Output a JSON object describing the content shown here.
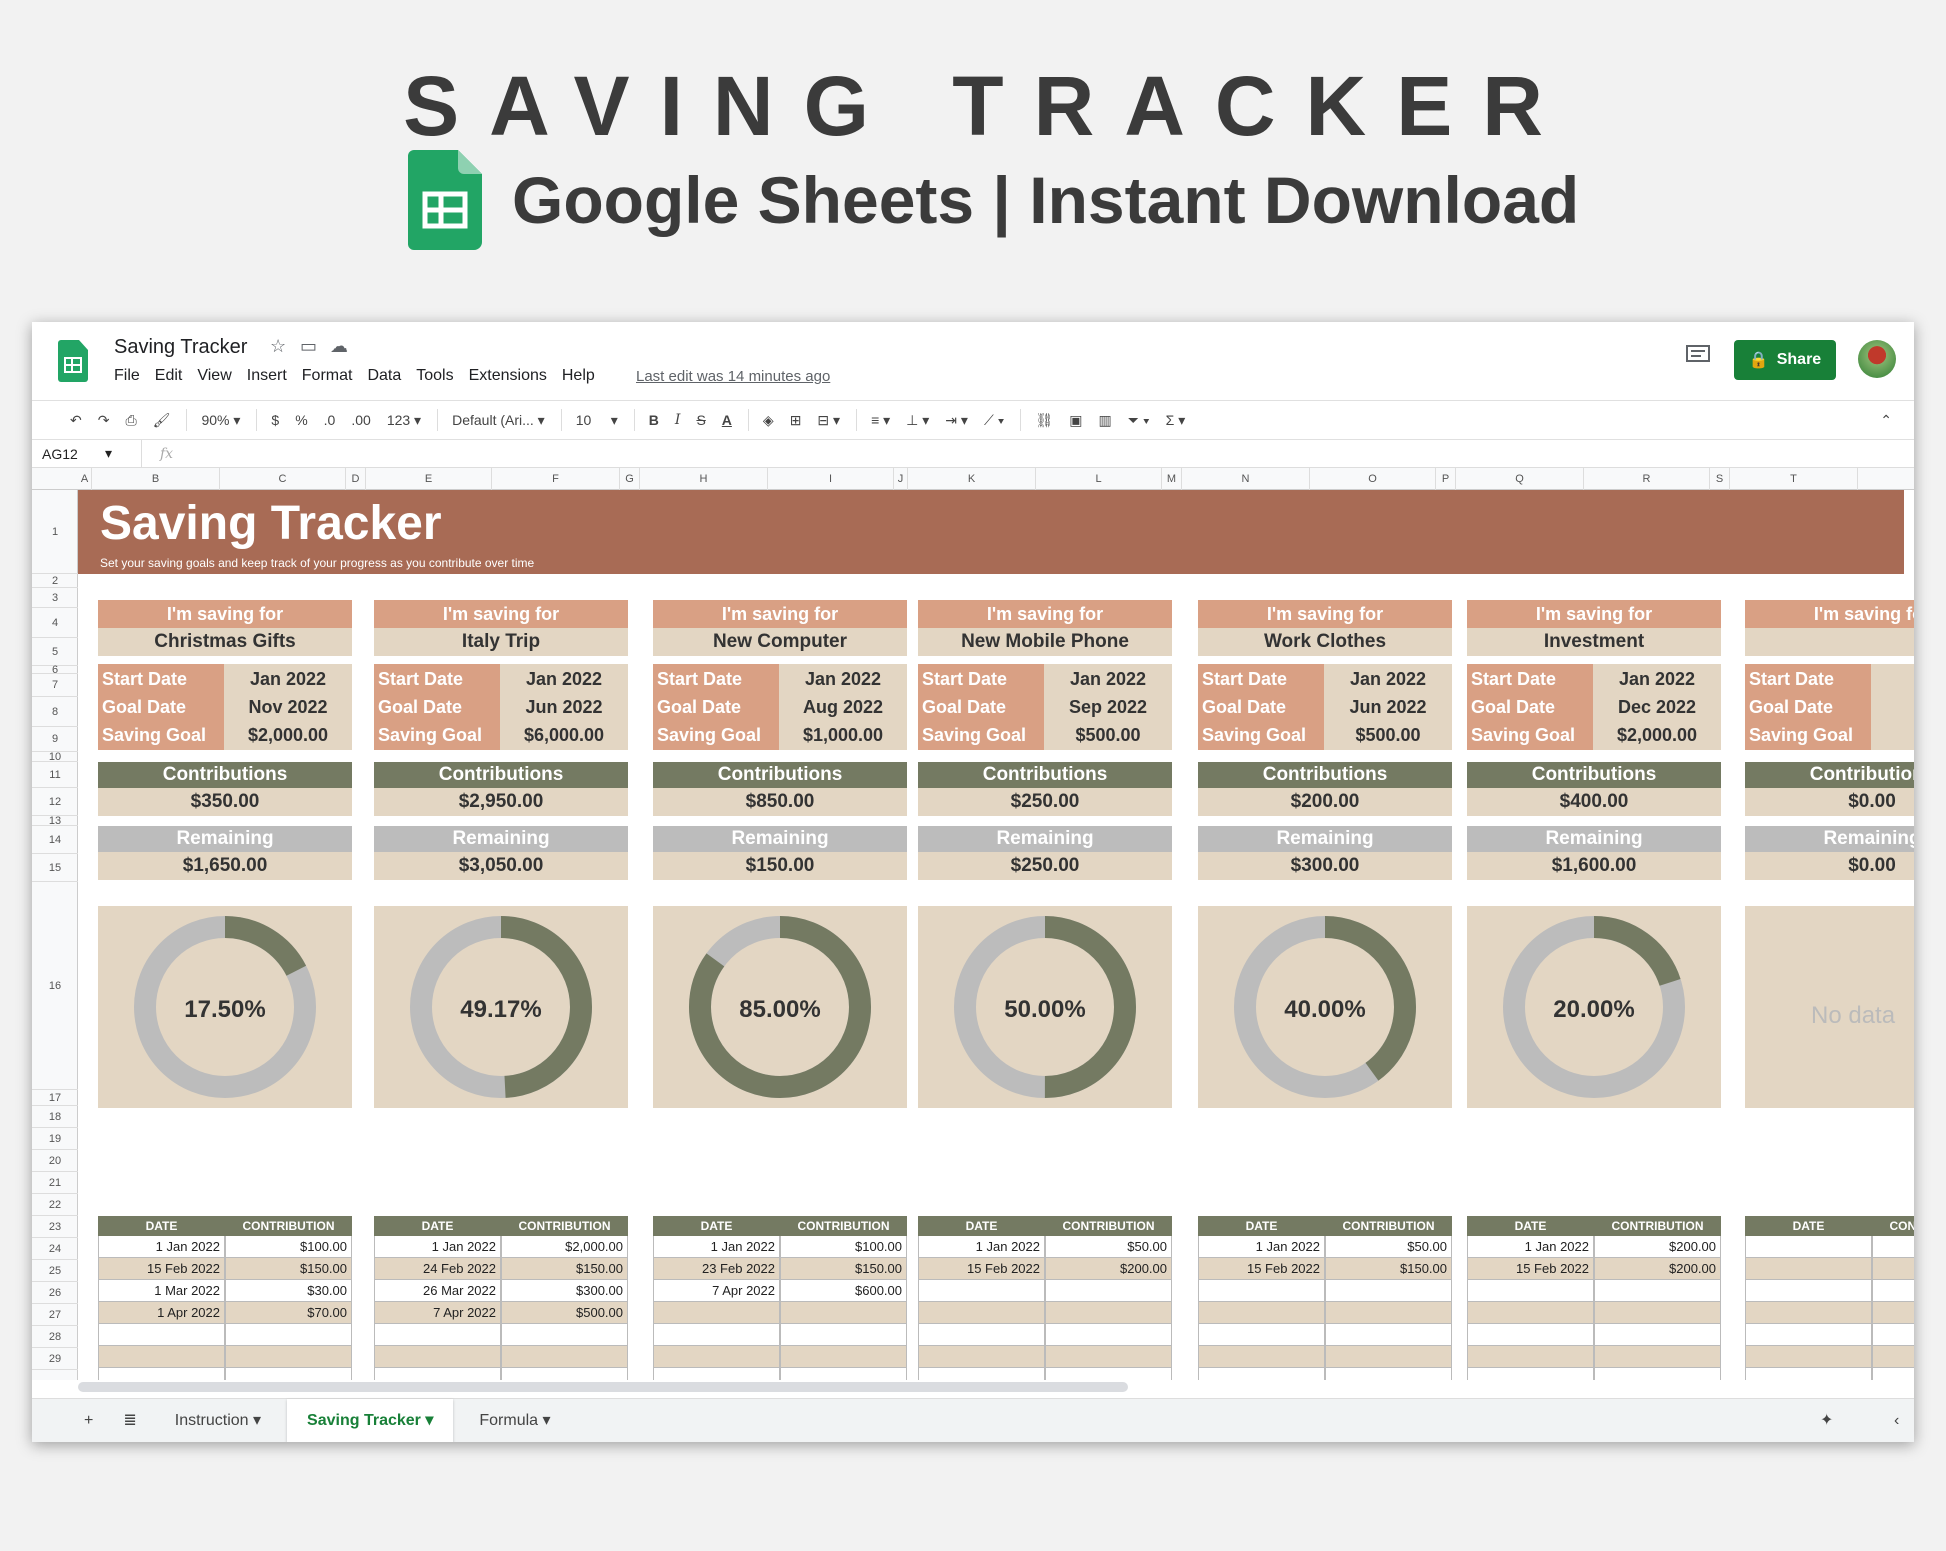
{
  "hero": {
    "title": "SAVING TRACKER",
    "subtitle": "Google Sheets | Instant Download"
  },
  "doc": {
    "title": "Saving Tracker",
    "last_edit": "Last edit was 14 minutes ago",
    "share": "Share"
  },
  "menu": [
    "File",
    "Edit",
    "View",
    "Insert",
    "Format",
    "Data",
    "Tools",
    "Extensions",
    "Help"
  ],
  "toolbar": {
    "zoom": "90%",
    "currency": "$",
    "percent": "%",
    "dec_less": ".0",
    "dec_more": ".00",
    "format": "123",
    "font": "Default (Ari...",
    "size": "10",
    "bold": "B",
    "italic": "I",
    "strike": "S",
    "textcolor": "A",
    "sum": "Σ"
  },
  "name_box": "AG12",
  "fx": "fx",
  "columns": [
    "A",
    "B",
    "C",
    "D",
    "E",
    "F",
    "G",
    "H",
    "I",
    "J",
    "K",
    "L",
    "M",
    "N",
    "O",
    "P",
    "Q",
    "R",
    "S",
    "T"
  ],
  "rows": [
    "1",
    "2",
    "3",
    "4",
    "5",
    "6",
    "7",
    "8",
    "9",
    "10",
    "11",
    "12",
    "13",
    "14",
    "15",
    "16",
    "17",
    "18",
    "19",
    "20",
    "21",
    "22",
    "23",
    "24",
    "25",
    "26",
    "27",
    "28",
    "29"
  ],
  "banner": {
    "title": "Saving Tracker",
    "subtitle": "Set your saving goals and keep track of your progress as you contribute over time"
  },
  "labels": {
    "saving_for": "I'm saving for",
    "start": "Start Date",
    "goal": "Goal Date",
    "saving_goal": "Saving Goal",
    "contributions": "Contributions",
    "remaining": "Remaining",
    "date": "DATE",
    "contribution": "CONTRIBUTION",
    "no_data": "No data"
  },
  "colors": {
    "accent": "#a86b55",
    "salmon": "#d9a084",
    "beige": "#e3d6c3",
    "olive": "#747a62",
    "gray": "#bcbcbc",
    "share": "#188038"
  },
  "goals": [
    {
      "name": "Christmas Gifts",
      "start": "Jan 2022",
      "goal": "Nov 2022",
      "target": "$2,000.00",
      "contributions": "$350.00",
      "remaining": "$1,650.00",
      "pct_label": "17.50%",
      "pct": 0.175,
      "rows": [
        [
          "1 Jan 2022",
          "$100.00"
        ],
        [
          "15 Feb 2022",
          "$150.00"
        ],
        [
          "1 Mar 2022",
          "$30.00"
        ],
        [
          "1 Apr 2022",
          "$70.00"
        ]
      ]
    },
    {
      "name": "Italy Trip",
      "start": "Jan 2022",
      "goal": "Jun 2022",
      "target": "$6,000.00",
      "contributions": "$2,950.00",
      "remaining": "$3,050.00",
      "pct_label": "49.17%",
      "pct": 0.4917,
      "rows": [
        [
          "1 Jan 2022",
          "$2,000.00"
        ],
        [
          "24 Feb 2022",
          "$150.00"
        ],
        [
          "26 Mar 2022",
          "$300.00"
        ],
        [
          "7 Apr 2022",
          "$500.00"
        ]
      ]
    },
    {
      "name": "New Computer",
      "start": "Jan 2022",
      "goal": "Aug 2022",
      "target": "$1,000.00",
      "contributions": "$850.00",
      "remaining": "$150.00",
      "pct_label": "85.00%",
      "pct": 0.85,
      "rows": [
        [
          "1 Jan 2022",
          "$100.00"
        ],
        [
          "23 Feb 2022",
          "$150.00"
        ],
        [
          "7 Apr 2022",
          "$600.00"
        ]
      ]
    },
    {
      "name": "New Mobile Phone",
      "start": "Jan 2022",
      "goal": "Sep 2022",
      "target": "$500.00",
      "contributions": "$250.00",
      "remaining": "$250.00",
      "pct_label": "50.00%",
      "pct": 0.5,
      "rows": [
        [
          "1 Jan 2022",
          "$50.00"
        ],
        [
          "15 Feb 2022",
          "$200.00"
        ]
      ]
    },
    {
      "name": "Work Clothes",
      "start": "Jan 2022",
      "goal": "Jun 2022",
      "target": "$500.00",
      "contributions": "$200.00",
      "remaining": "$300.00",
      "pct_label": "40.00%",
      "pct": 0.4,
      "rows": [
        [
          "1 Jan 2022",
          "$50.00"
        ],
        [
          "15 Feb 2022",
          "$150.00"
        ]
      ]
    },
    {
      "name": "Investment",
      "start": "Jan 2022",
      "goal": "Dec 2022",
      "target": "$2,000.00",
      "contributions": "$400.00",
      "remaining": "$1,600.00",
      "pct_label": "20.00%",
      "pct": 0.2,
      "rows": [
        [
          "1 Jan 2022",
          "$200.00"
        ],
        [
          "15 Feb 2022",
          "$200.00"
        ]
      ]
    },
    {
      "name": "",
      "start": "",
      "goal": "",
      "target": "",
      "contributions": "$0.00",
      "remaining": "$0.00",
      "pct_label": "",
      "pct": null,
      "rows": []
    }
  ],
  "sheets": [
    "Instruction",
    "Saving Tracker",
    "Formula"
  ],
  "active_sheet": "Saving Tracker"
}
